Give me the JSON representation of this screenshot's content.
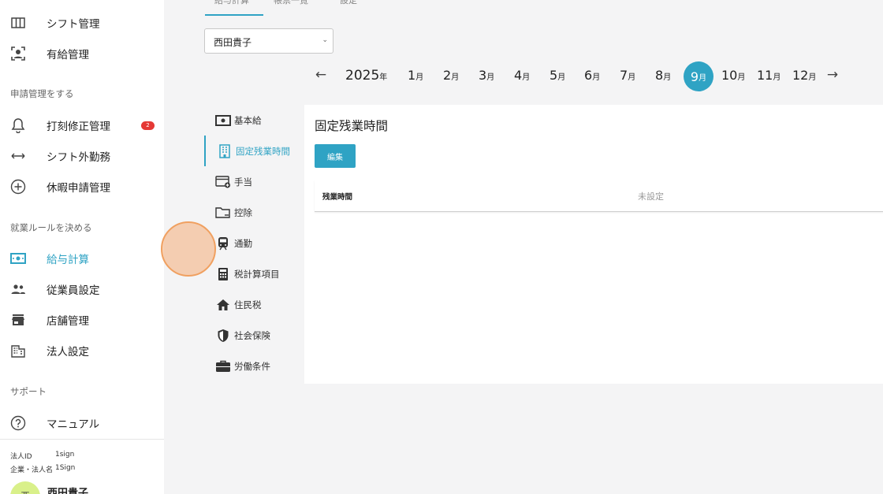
{
  "sidebar": {
    "top_items": [
      {
        "label": "シフト管理",
        "icon": "columns-icon"
      },
      {
        "label": "有給管理",
        "icon": "user-frame-icon"
      }
    ],
    "sections": [
      {
        "head": "申請管理をする"
      },
      {
        "head": "就業ルールを決める"
      },
      {
        "head": "サポート"
      }
    ],
    "request_items": [
      {
        "label": "打刻修正管理",
        "icon": "bell-icon",
        "badge": "2"
      },
      {
        "label": "シフト外勤務",
        "icon": "arrows-horizontal-icon"
      },
      {
        "label": "休暇申請管理",
        "icon": "plus-circle-icon"
      }
    ],
    "rule_items": [
      {
        "label": "給与計算",
        "icon": "money-icon",
        "active": true
      },
      {
        "label": "従業員設定",
        "icon": "people-icon"
      },
      {
        "label": "店舗管理",
        "icon": "store-icon"
      },
      {
        "label": "法人設定",
        "icon": "building-icon"
      }
    ],
    "support_items": [
      {
        "label": "マニュアル",
        "icon": "help-circle-icon"
      }
    ],
    "meta": {
      "corp_id_label": "法人ID",
      "corp_id": "1sign",
      "company_label": "企業・法人名",
      "company": "1Sign"
    },
    "user": {
      "name": "西田貴子",
      "avatar_initial": "西"
    }
  },
  "top_tabs": [
    {
      "label": "給与計算",
      "active": true
    },
    {
      "label": "帳票一覧"
    },
    {
      "label": "設定"
    }
  ],
  "employee_select": {
    "value": "西田貴子"
  },
  "month_bar": {
    "year": "2025",
    "year_suffix": "年",
    "month_suffix": "月",
    "months": [
      "1",
      "2",
      "3",
      "4",
      "5",
      "6",
      "7",
      "8",
      "9",
      "10",
      "11",
      "12"
    ],
    "active_month": "9"
  },
  "submenu": [
    {
      "label": "基本給",
      "icon": "money-icon"
    },
    {
      "label": "固定残業時間",
      "icon": "office-building-icon",
      "active": true
    },
    {
      "label": "手当",
      "icon": "card-plus-icon"
    },
    {
      "label": "控除",
      "icon": "folder-minus-icon"
    },
    {
      "label": "通勤",
      "icon": "train-icon"
    },
    {
      "label": "税計算項目",
      "icon": "calculator-icon"
    },
    {
      "label": "住民税",
      "icon": "home-icon"
    },
    {
      "label": "社会保険",
      "icon": "shield-icon"
    },
    {
      "label": "労働条件",
      "icon": "briefcase-icon"
    }
  ],
  "panel": {
    "title": "固定残業時間",
    "edit_label": "編集",
    "row_key": "残業時間",
    "row_value": "未設定"
  },
  "colors": {
    "accent": "#2fa3c4",
    "badge": "#e53935"
  }
}
